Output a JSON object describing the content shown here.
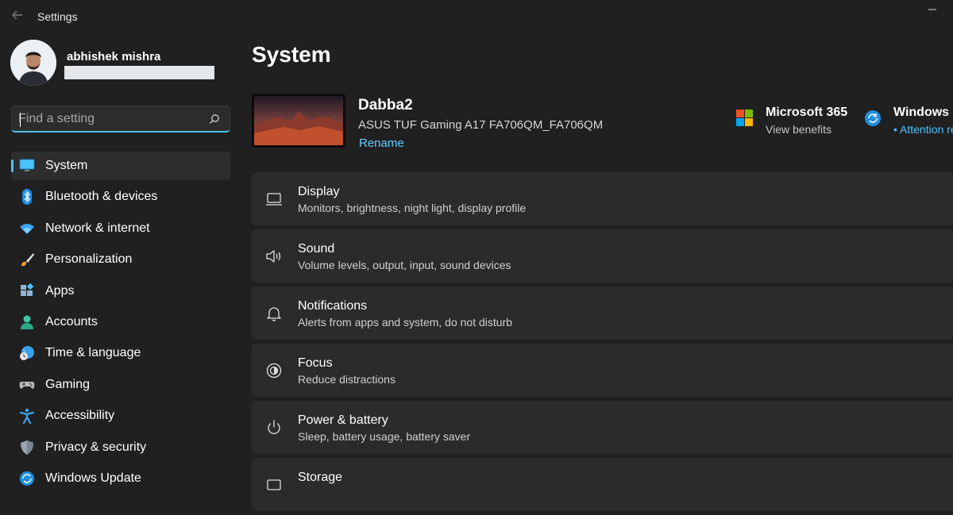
{
  "window": {
    "title": "Settings",
    "minimize_icon": "minimize-icon",
    "back_icon": "back-arrow-icon"
  },
  "profile": {
    "name": "abhishek mishra",
    "avatar_icon": "user-avatar"
  },
  "search": {
    "placeholder": "Find a setting",
    "icon": "search-icon"
  },
  "sidebar": {
    "items": [
      {
        "label": "System",
        "icon": "monitor-icon",
        "active": true
      },
      {
        "label": "Bluetooth & devices",
        "icon": "bluetooth-icon"
      },
      {
        "label": "Network & internet",
        "icon": "wifi-icon"
      },
      {
        "label": "Personalization",
        "icon": "brush-icon"
      },
      {
        "label": "Apps",
        "icon": "apps-icon"
      },
      {
        "label": "Accounts",
        "icon": "person-icon"
      },
      {
        "label": "Time & language",
        "icon": "globe-clock-icon"
      },
      {
        "label": "Gaming",
        "icon": "gamepad-icon"
      },
      {
        "label": "Accessibility",
        "icon": "accessibility-icon"
      },
      {
        "label": "Privacy & security",
        "icon": "shield-icon"
      },
      {
        "label": "Windows Update",
        "icon": "update-icon"
      }
    ]
  },
  "main": {
    "title": "System",
    "device": {
      "name": "Dabba2",
      "model": "ASUS TUF Gaming A17 FA706QM_FA706QM",
      "rename_label": "Rename"
    },
    "promos": [
      {
        "title": "Microsoft 365",
        "subtitle": "View benefits",
        "icon": "microsoft-logo-icon"
      },
      {
        "title": "Windows Update",
        "subtitle": "• Attention required",
        "icon": "sync-icon"
      }
    ],
    "cards": [
      {
        "title": "Display",
        "subtitle": "Monitors, brightness, night light, display profile",
        "icon": "laptop-icon"
      },
      {
        "title": "Sound",
        "subtitle": "Volume levels, output, input, sound devices",
        "icon": "speaker-icon"
      },
      {
        "title": "Notifications",
        "subtitle": "Alerts from apps and system, do not disturb",
        "icon": "bell-icon"
      },
      {
        "title": "Focus",
        "subtitle": "Reduce distractions",
        "icon": "focus-icon"
      },
      {
        "title": "Power & battery",
        "subtitle": "Sleep, battery usage, battery saver",
        "icon": "power-icon"
      },
      {
        "title": "Storage",
        "subtitle": "",
        "icon": "storage-icon"
      }
    ]
  },
  "colors": {
    "background": "#202020",
    "card": "#2b2b2b",
    "accent": "#4cc2ff",
    "link": "#60cdff"
  }
}
